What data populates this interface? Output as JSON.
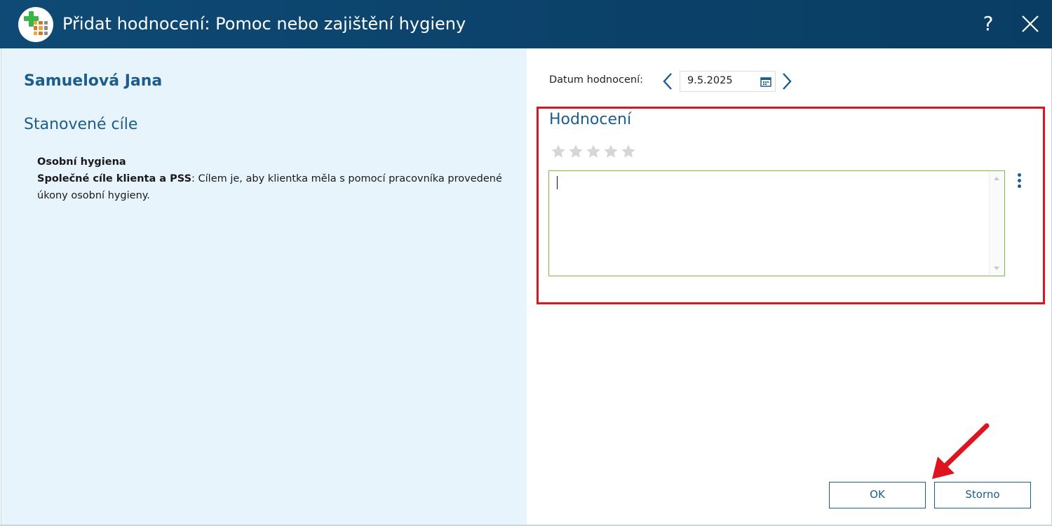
{
  "window": {
    "title": "Přidat hodnocení: Pomoc nebo zajištění hygieny",
    "help_label": "?",
    "close_icon": "close-icon",
    "logo_icon": "app-logo-icon"
  },
  "left": {
    "client_name": "Samuelová Jana",
    "section_title": "Stanovené cíle",
    "goal": {
      "name": "Osobní hygiena",
      "shared_label": "Společné cíle klienta a PSS",
      "shared_text": ": Cílem je, aby klientka měla s pomocí pracovníka provedené úkony osobní hygieny."
    }
  },
  "right": {
    "date_label": "Datum hodnocení:",
    "date_value": "9.5.2025",
    "rating_title": "Hodnocení",
    "stars_total": 5,
    "stars_filled": 0,
    "comment_value": "",
    "ok_label": "OK",
    "cancel_label": "Storno"
  },
  "colors": {
    "titlebar": "#0b4169",
    "accent": "#1d5d8c",
    "left_background": "#e8f4fc",
    "highlight": "#e0141e",
    "input_border": "#7cba44",
    "star_empty": "#d6d6d6"
  }
}
